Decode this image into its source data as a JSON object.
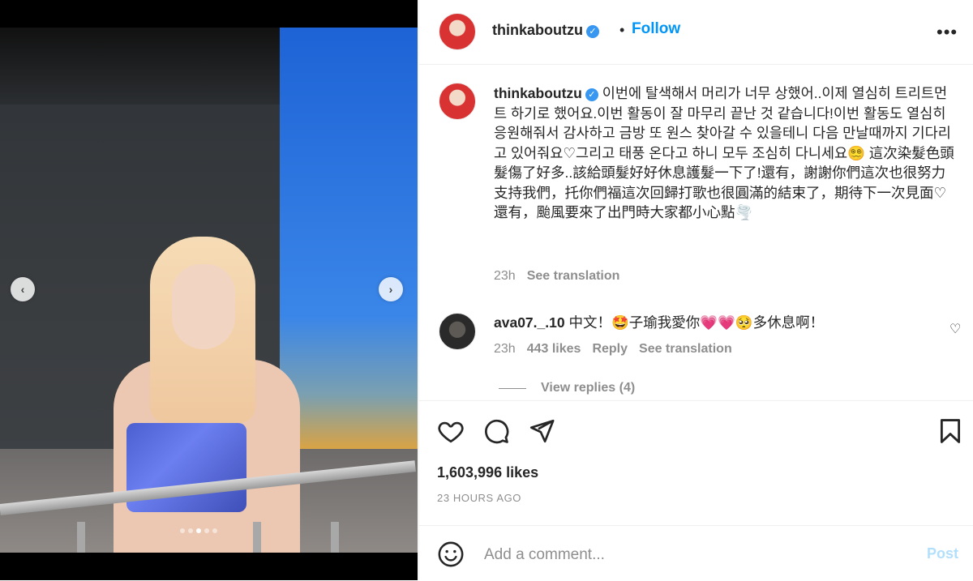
{
  "post": {
    "username": "thinkaboutzu",
    "follow_label": "Follow",
    "separator": "•",
    "more_label": "•••"
  },
  "caption": {
    "username": "thinkaboutzu",
    "text": "이번에 탈색해서 머리가 너무 상했어..이제 열심히 트리트먼트 하기로 했어요.이번 활동이 잘 마무리 끝난 것 같습니다!이번 활동도 열심히 응원해줘서 감사하고 금방 또 원스 찾아갈 수 있을테니 다음 만날때까지 기다리고 있어줘요♡그리고 태풍 온다고 하니 모두 조심히 다니세요😵‍💫 這次染髮色頭髮傷了好多..該給頭髮好好休息護髮一下了!還有，謝謝你們這次也很努力支持我們，托你們福這次回歸打歌也很圓滿的結束了，期待下一次見面♡還有，颱風要來了出門時大家都小心點🌪️",
    "time": "23h",
    "see_translation": "See translation"
  },
  "comment": {
    "username": "ava07._.10",
    "text": "中文！🤩子瑜我愛你💗💗🥺多休息啊！",
    "time": "23h",
    "likes": "443 likes",
    "reply": "Reply",
    "see_translation": "See translation",
    "view_replies": "View replies (4)"
  },
  "stats": {
    "likes": "1,603,996 likes",
    "time_ago": "23 HOURS AGO"
  },
  "add_comment": {
    "placeholder": "Add a comment...",
    "post_label": "Post"
  },
  "carousel": {
    "prev_label": "‹",
    "next_label": "›"
  },
  "colors": {
    "accent": "#0095f6",
    "post_disabled": "#b2dffc",
    "secondary_text": "#8e8e8e"
  },
  "icons": [
    "heart-icon",
    "comment-icon",
    "share-icon",
    "bookmark-icon",
    "emoji-icon",
    "more-icon",
    "verified-icon"
  ]
}
